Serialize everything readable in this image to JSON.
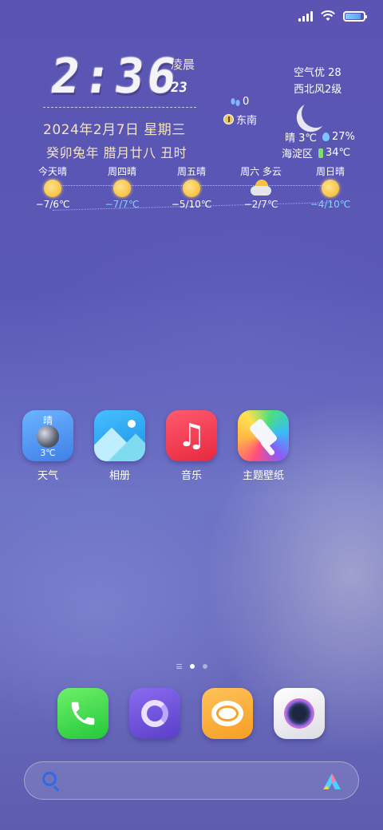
{
  "status_bar": {
    "icons": [
      "signal-icon",
      "wifi-icon",
      "battery-icon"
    ],
    "battery_level": 0.85
  },
  "clock_widget": {
    "time": "2:36",
    "period": "凌晨",
    "seconds": "23",
    "date": "2024年2月7日 星期三",
    "lunar": "癸卯兔年 腊月廿八  丑时",
    "steps": "0",
    "direction": "东南",
    "air_quality": "空气优 28",
    "wind": "西北风2级",
    "current_condition": "晴 3℃",
    "humidity": "27%",
    "district": "海淀区",
    "device_temp": "34℃"
  },
  "forecast": [
    {
      "day": "今天晴",
      "temp": "−7/6℃",
      "icon": "sun-icon",
      "color": "#ffffff"
    },
    {
      "day": "周四晴",
      "temp": "−7/7℃",
      "icon": "sun-icon",
      "color": "#7fd4ff"
    },
    {
      "day": "周五晴",
      "temp": "−5/10℃",
      "icon": "sun-icon",
      "color": "#ffffff"
    },
    {
      "day": "周六 多云",
      "temp": "−2/7℃",
      "icon": "cloudy-icon",
      "color": "#ffffff"
    },
    {
      "day": "周日晴",
      "temp": "−4/10℃",
      "icon": "sun-icon",
      "color": "#7fd4ff"
    }
  ],
  "apps": [
    {
      "label": "天气",
      "icon": "weather-app-icon",
      "badge_text": "晴",
      "badge_temp": "3℃"
    },
    {
      "label": "相册",
      "icon": "gallery-app-icon"
    },
    {
      "label": "音乐",
      "icon": "music-app-icon"
    },
    {
      "label": "主题壁纸",
      "icon": "theme-app-icon"
    }
  ],
  "dock": [
    {
      "icon": "phone-app-icon"
    },
    {
      "icon": "browser-app-icon"
    },
    {
      "icon": "messages-app-icon"
    },
    {
      "icon": "camera-app-icon"
    }
  ],
  "search": {
    "icon": "search-icon",
    "assistant_icon": "ai-assistant-icon"
  },
  "pager": {
    "pages": 2,
    "active_page": 1
  },
  "colors": {
    "wallpaper_top": "#5b54b3",
    "wallpaper_mid": "#6e74c6",
    "date_text": "#f3e4c2",
    "accent_blue": "#7fd4ff"
  }
}
